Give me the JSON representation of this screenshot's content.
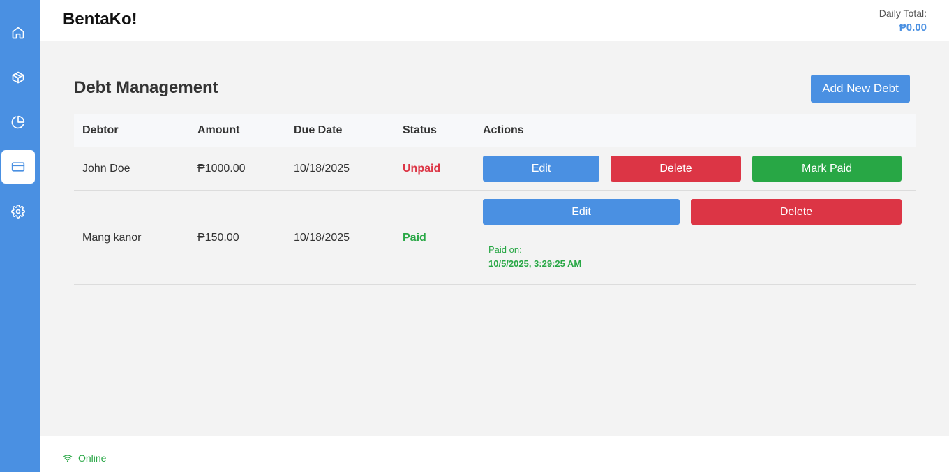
{
  "app": {
    "brand": "BentaKo!"
  },
  "header": {
    "daily_total_label": "Daily Total:",
    "daily_total_value": "₱0.00"
  },
  "sidebar": {
    "items": [
      {
        "icon": "home-icon",
        "active": false
      },
      {
        "icon": "box-icon",
        "active": false
      },
      {
        "icon": "pie-chart-icon",
        "active": false
      },
      {
        "icon": "credit-card-icon",
        "active": true
      },
      {
        "icon": "gear-icon",
        "active": false
      }
    ]
  },
  "page": {
    "title": "Debt Management",
    "add_button": "Add New Debt"
  },
  "table": {
    "headers": [
      "Debtor",
      "Amount",
      "Due Date",
      "Status",
      "Actions"
    ],
    "rows": [
      {
        "debtor": "John Doe",
        "amount": "₱1000.00",
        "due_date": "10/18/2025",
        "status": "Unpaid",
        "actions": {
          "edit": "Edit",
          "delete": "Delete",
          "mark_paid": "Mark Paid"
        }
      },
      {
        "debtor": "Mang kanor",
        "amount": "₱150.00",
        "due_date": "10/18/2025",
        "status": "Paid",
        "actions": {
          "edit": "Edit",
          "delete": "Delete"
        },
        "paid_on_label": "Paid on:",
        "paid_on_value": "10/5/2025, 3:29:25 AM"
      }
    ]
  },
  "footer": {
    "status": "Online"
  },
  "colors": {
    "primary": "#4a90e2",
    "danger": "#dc3545",
    "success": "#28a745"
  }
}
